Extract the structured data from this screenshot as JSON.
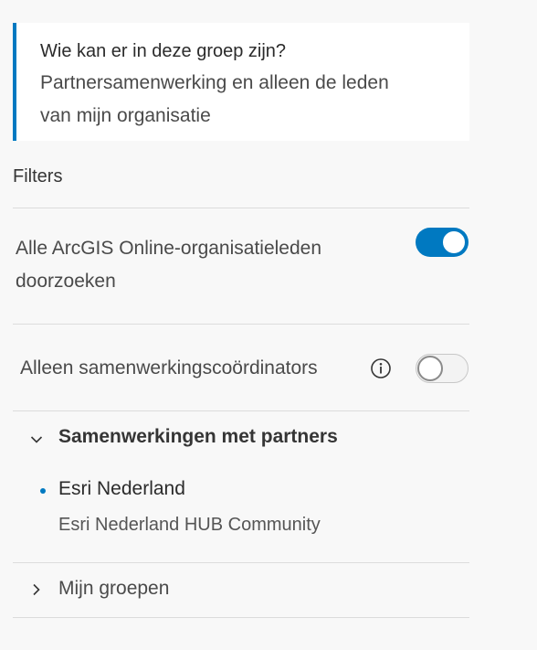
{
  "notice": {
    "title": "Wie kan er in deze groep zijn?",
    "line1": "Partnersamenwerking en alleen de leden",
    "line2": "van mijn organisatie"
  },
  "filters": {
    "heading": "Filters",
    "search_all": {
      "line1": "Alle ArcGIS Online-organisatieleden",
      "line2": "doorzoeken",
      "enabled": true
    },
    "coordinators_only": {
      "label": "Alleen samenwerkingscoördinators",
      "enabled": false,
      "icon": "info-icon"
    }
  },
  "partner_collaborations": {
    "heading": "Samenwerkingen met partners",
    "expanded": true,
    "items": [
      {
        "name": "Esri Nederland",
        "subtitle": "Esri Nederland HUB Community"
      }
    ]
  },
  "my_groups": {
    "label": "Mijn groepen",
    "expanded": false
  },
  "colors": {
    "accent": "#0079c1",
    "background": "#f8f8f8",
    "text": "#353535"
  }
}
